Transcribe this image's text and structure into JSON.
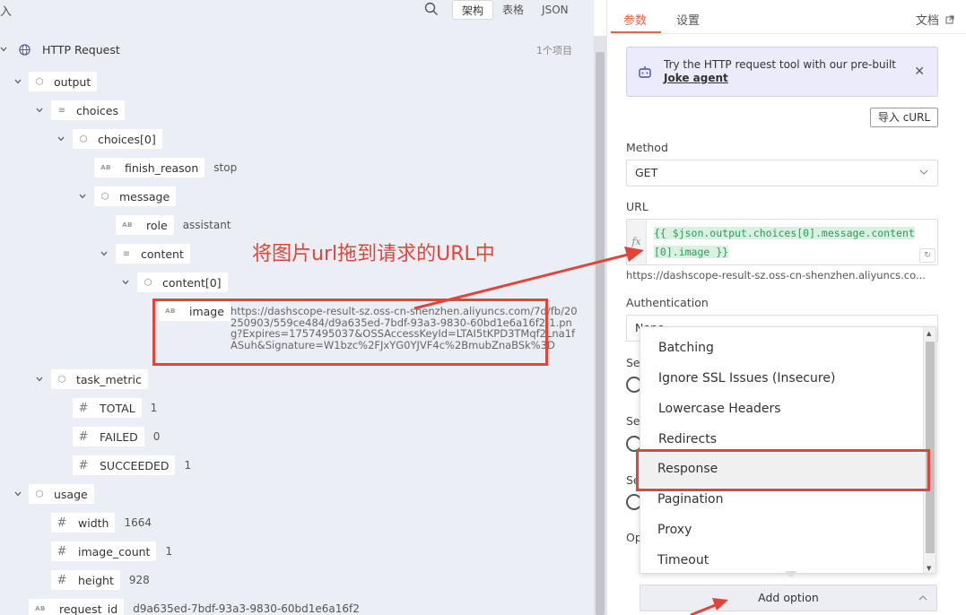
{
  "left": {
    "top_label": "入",
    "view_tabs": [
      "架构",
      "表格",
      "JSON"
    ],
    "item_count": "1个项目",
    "tree": {
      "root": "HTTP Request",
      "output": "output",
      "choices": "choices",
      "choices0": "choices[0]",
      "finish_reason": {
        "key": "finish_reason",
        "value": "stop"
      },
      "message": "message",
      "role": {
        "key": "role",
        "value": "assistant"
      },
      "content": "content",
      "content0": "content[0]",
      "image": {
        "key": "image",
        "value": "https://dashscope-result-sz.oss-cn-shenzhen.aliyuncs.com/7d/fb/20250903/559ce484/d9a635ed-7bdf-93a3-9830-60bd1e6a16f2-1.png?Expires=1757495037&OSSAccessKeyId=LTAI5tKPD3TMqf2Lna1fASuh&Signature=W1bzc%2FJxYG0YJVF4c%2BmubZnaBSk%3D"
      },
      "task_metric": "task_metric",
      "total": {
        "key": "TOTAL",
        "value": "1"
      },
      "failed": {
        "key": "FAILED",
        "value": "0"
      },
      "succeeded": {
        "key": "SUCCEEDED",
        "value": "1"
      },
      "usage": "usage",
      "width": {
        "key": "width",
        "value": "1664"
      },
      "image_count": {
        "key": "image_count",
        "value": "1"
      },
      "height": {
        "key": "height",
        "value": "928"
      },
      "request_id": {
        "key": "request_id",
        "value": "d9a635ed-7bdf-93a3-9830-60bd1e6a16f2"
      }
    },
    "annotation": "将图片url拖到请求的URL中"
  },
  "right": {
    "tabs": [
      "参数",
      "设置"
    ],
    "docs": "文档",
    "banner": {
      "text": "Try the HTTP request tool with our pre-built",
      "link": "Joke agent"
    },
    "import_curl": "导入 cURL",
    "method_label": "Method",
    "method_value": "GET",
    "url_label": "URL",
    "url_expr_line1": "{{ $json.output.choices[0].message.content",
    "url_expr_line2": "[0].image }}",
    "url_preview": "https://dashscope-result-sz.oss-cn-shenzhen.aliyuncs.co...",
    "auth_label": "Authentication",
    "auth_value": "None",
    "partial_labels": [
      "Se",
      "Se",
      "Se",
      "Op"
    ],
    "dropdown_items": [
      "Batching",
      "Ignore SSL Issues (Insecure)",
      "Lowercase Headers",
      "Redirects",
      "Response",
      "Pagination",
      "Proxy",
      "Timeout"
    ],
    "add_option": "Add option"
  },
  "colors": {
    "accent": "#e8623c",
    "annotation_red": "#e0453a",
    "expression_green": "#2e9b5e"
  }
}
